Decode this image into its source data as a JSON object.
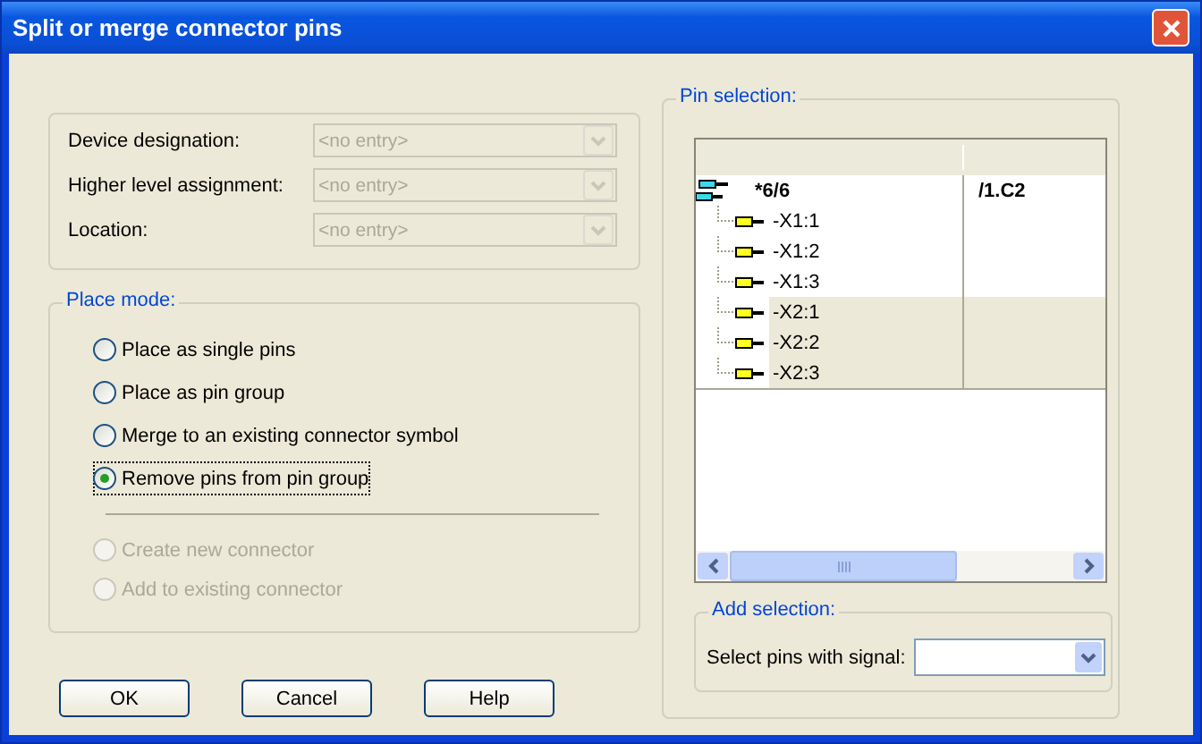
{
  "window": {
    "title": "Split or merge connector pins"
  },
  "fields": [
    {
      "label": "Device designation:",
      "value": "<no entry>",
      "disabled": true
    },
    {
      "label": "Higher level assignment:",
      "value": "<no entry>",
      "disabled": true
    },
    {
      "label": "Location:",
      "value": "<no entry>",
      "disabled": true
    }
  ],
  "place_mode": {
    "title": "Place mode:",
    "options": [
      {
        "label": "Place as single pins",
        "selected": false,
        "disabled": false
      },
      {
        "label": "Place as pin group",
        "selected": false,
        "disabled": false
      },
      {
        "label": "Merge to an existing connector symbol",
        "selected": false,
        "disabled": false
      },
      {
        "label": "Remove pins from pin group",
        "selected": true,
        "disabled": false
      }
    ],
    "sub_options": [
      {
        "label": "Create new connector",
        "selected": false,
        "disabled": true
      },
      {
        "label": "Add to existing connector",
        "selected": false,
        "disabled": true
      }
    ]
  },
  "buttons": [
    "OK",
    "Cancel",
    "Help"
  ],
  "pin_selection": {
    "title": "Pin selection:",
    "tree": [
      {
        "name": "*6/6",
        "column_2": "/1.C2",
        "children": [
          {
            "name": "-X1:1",
            "selected": false
          },
          {
            "name": "-X1:2",
            "selected": false
          },
          {
            "name": "-X1:3",
            "selected": false
          },
          {
            "name": "-X2:1",
            "selected": true
          },
          {
            "name": "-X2:2",
            "selected": true
          },
          {
            "name": "-X2:3",
            "selected": true
          }
        ]
      }
    ]
  },
  "add_selection": {
    "title": "Add selection:",
    "label": "Select pins with signal:"
  }
}
